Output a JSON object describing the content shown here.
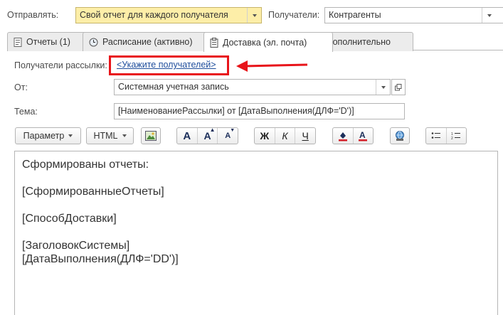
{
  "top": {
    "send_label": "Отправлять:",
    "send_value": "Свой отчет для каждого получателя",
    "recipients_label": "Получатели:",
    "recipients_value": "Контрагенты"
  },
  "tabs": [
    {
      "label": "Отчеты (1)",
      "icon": "document-icon"
    },
    {
      "label": "Расписание (активно)",
      "icon": "clock-icon"
    },
    {
      "label": "Доставка (эл. почта)",
      "icon": "clipboard-icon",
      "active": true
    },
    {
      "label": "Дополнительно",
      "icon": ""
    }
  ],
  "form": {
    "mail_recipients_label": "Получатели рассылки:",
    "mail_recipients_link": "<Укажите получателей>",
    "from_label": "От:",
    "from_value": "Системная учетная запись",
    "subject_label": "Тема:",
    "subject_value": "[НаименованиеРассылки] от [ДатаВыполнения(ДЛФ='D')]"
  },
  "toolbar": {
    "param_label": "Параметр",
    "html_label": "HTML",
    "bold_label": "Ж",
    "italic_label": "К",
    "underline_label": "Ч",
    "font_a_label": "A"
  },
  "editor": {
    "lines": [
      "Сформированы отчеты:",
      "",
      "[СформированныеОтчеты]",
      "",
      "[СпособДоставки]",
      "",
      "[ЗаголовокСистемы]",
      "[ДатаВыполнения(ДЛФ='DD')]"
    ]
  },
  "colors": {
    "highlight_box": "#e8141a",
    "link": "#1f4e9c",
    "yellow_field": "#fdeea8"
  }
}
